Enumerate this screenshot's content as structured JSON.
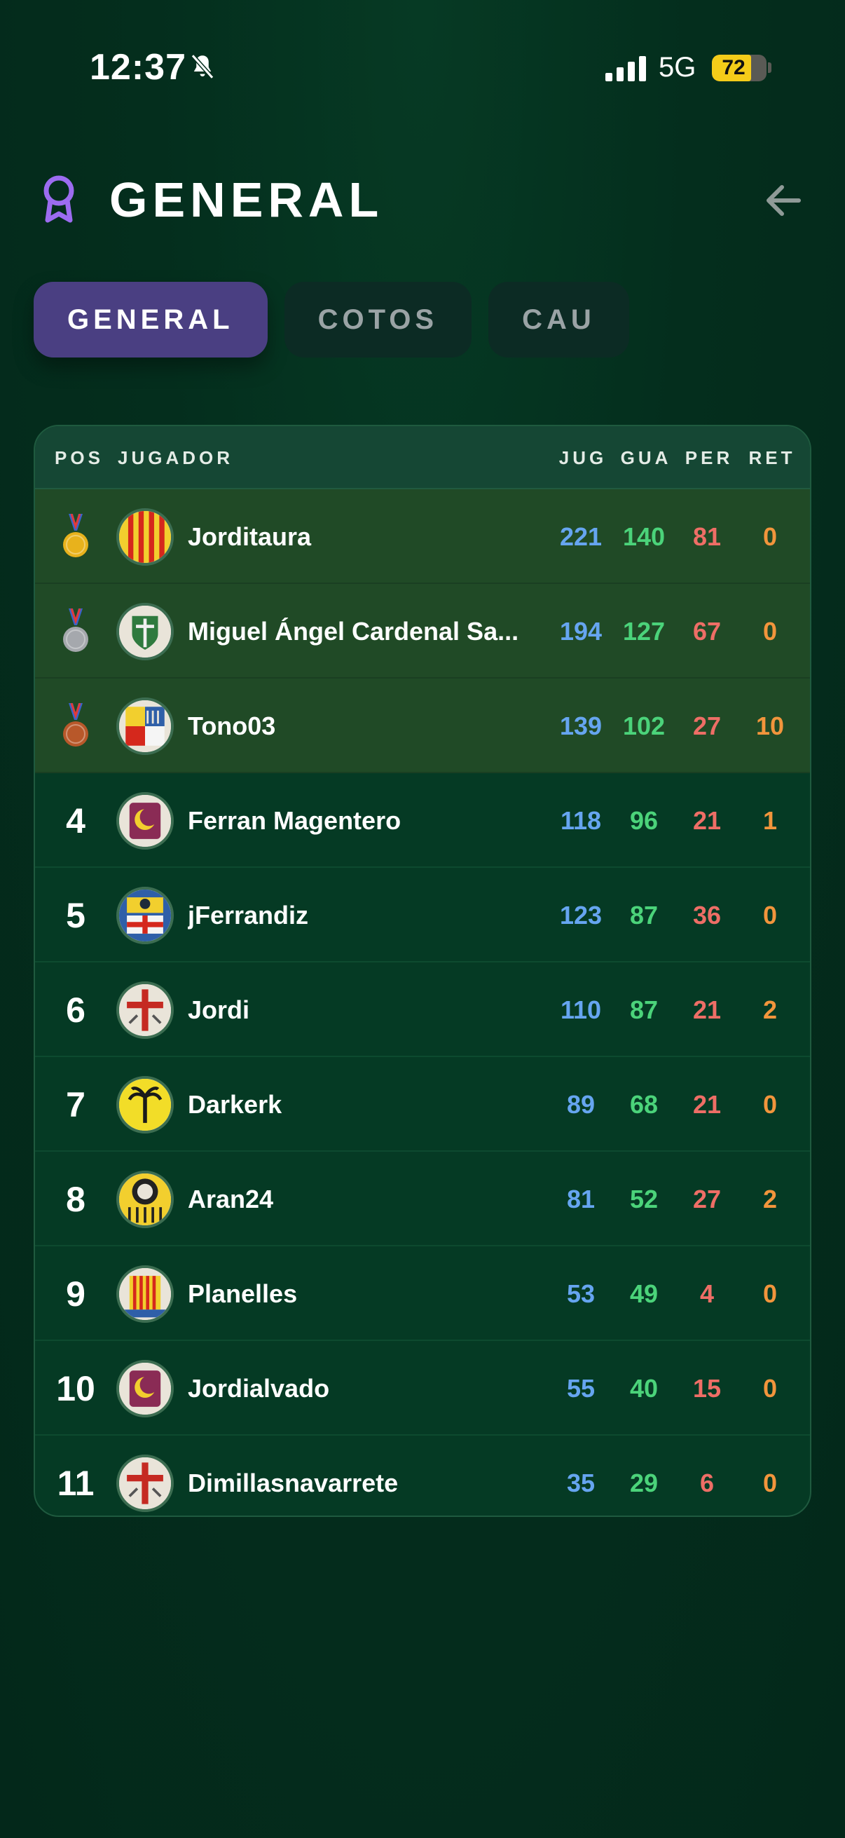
{
  "status_bar": {
    "time": "12:37",
    "network": "5G",
    "battery": "72",
    "battery_level": 0.72
  },
  "header": {
    "title": "GENERAL"
  },
  "tabs": [
    {
      "label": "GENERAL",
      "active": true
    },
    {
      "label": "COTOS",
      "active": false
    },
    {
      "label": "CAU",
      "active": false
    }
  ],
  "table": {
    "columns": {
      "pos": "POS",
      "player": "JUGADOR",
      "jug": "JUG",
      "gua": "GUA",
      "per": "PER",
      "ret": "RET"
    },
    "rows": [
      {
        "pos": "1",
        "medal": "gold",
        "name": "Jorditaura",
        "avatar": "senyera-shield-icon",
        "jug": "221",
        "gua": "140",
        "per": "81",
        "ret": "0"
      },
      {
        "pos": "2",
        "medal": "silver",
        "name": "Miguel Ángel Cardenal Sa...",
        "avatar": "green-crest-icon",
        "jug": "194",
        "gua": "127",
        "per": "67",
        "ret": "0"
      },
      {
        "pos": "3",
        "medal": "bronze",
        "name": "Tono03",
        "avatar": "quartered-crest-icon",
        "jug": "139",
        "gua": "102",
        "per": "27",
        "ret": "10"
      },
      {
        "pos": "4",
        "name": "Ferran Magentero",
        "avatar": "crescent-crest-icon",
        "jug": "118",
        "gua": "96",
        "per": "21",
        "ret": "1"
      },
      {
        "pos": "5",
        "name": "jFerrandiz",
        "avatar": "cross-crest-icon",
        "jug": "123",
        "gua": "87",
        "per": "36",
        "ret": "0"
      },
      {
        "pos": "6",
        "name": "Jordi",
        "avatar": "red-cross-crest-icon",
        "jug": "110",
        "gua": "87",
        "per": "21",
        "ret": "2"
      },
      {
        "pos": "7",
        "name": "Darkerk",
        "avatar": "palm-crest-icon",
        "jug": "89",
        "gua": "68",
        "per": "21",
        "ret": "0"
      },
      {
        "pos": "8",
        "name": "Aran24",
        "avatar": "round-crest-icon",
        "jug": "81",
        "gua": "52",
        "per": "27",
        "ret": "2"
      },
      {
        "pos": "9",
        "name": "Planelles",
        "avatar": "striped-crest-icon",
        "jug": "53",
        "gua": "49",
        "per": "4",
        "ret": "0"
      },
      {
        "pos": "10",
        "name": "Jordialvado",
        "avatar": "crescent-crest-icon",
        "jug": "55",
        "gua": "40",
        "per": "15",
        "ret": "0"
      },
      {
        "pos": "11",
        "name": "Dimillasnavarrete",
        "avatar": "red-cross-crest-icon",
        "jug": "35",
        "gua": "29",
        "per": "6",
        "ret": "0"
      }
    ]
  },
  "colors": {
    "background": "#042e1d",
    "accent": "#4a3f82",
    "jug": "#66a5f0",
    "gua": "#4bd37a",
    "per": "#ee6e66",
    "ret": "#f2953c",
    "gold": "#e8b21c",
    "silver": "#a5a8ad",
    "bronze": "#b8582a"
  }
}
